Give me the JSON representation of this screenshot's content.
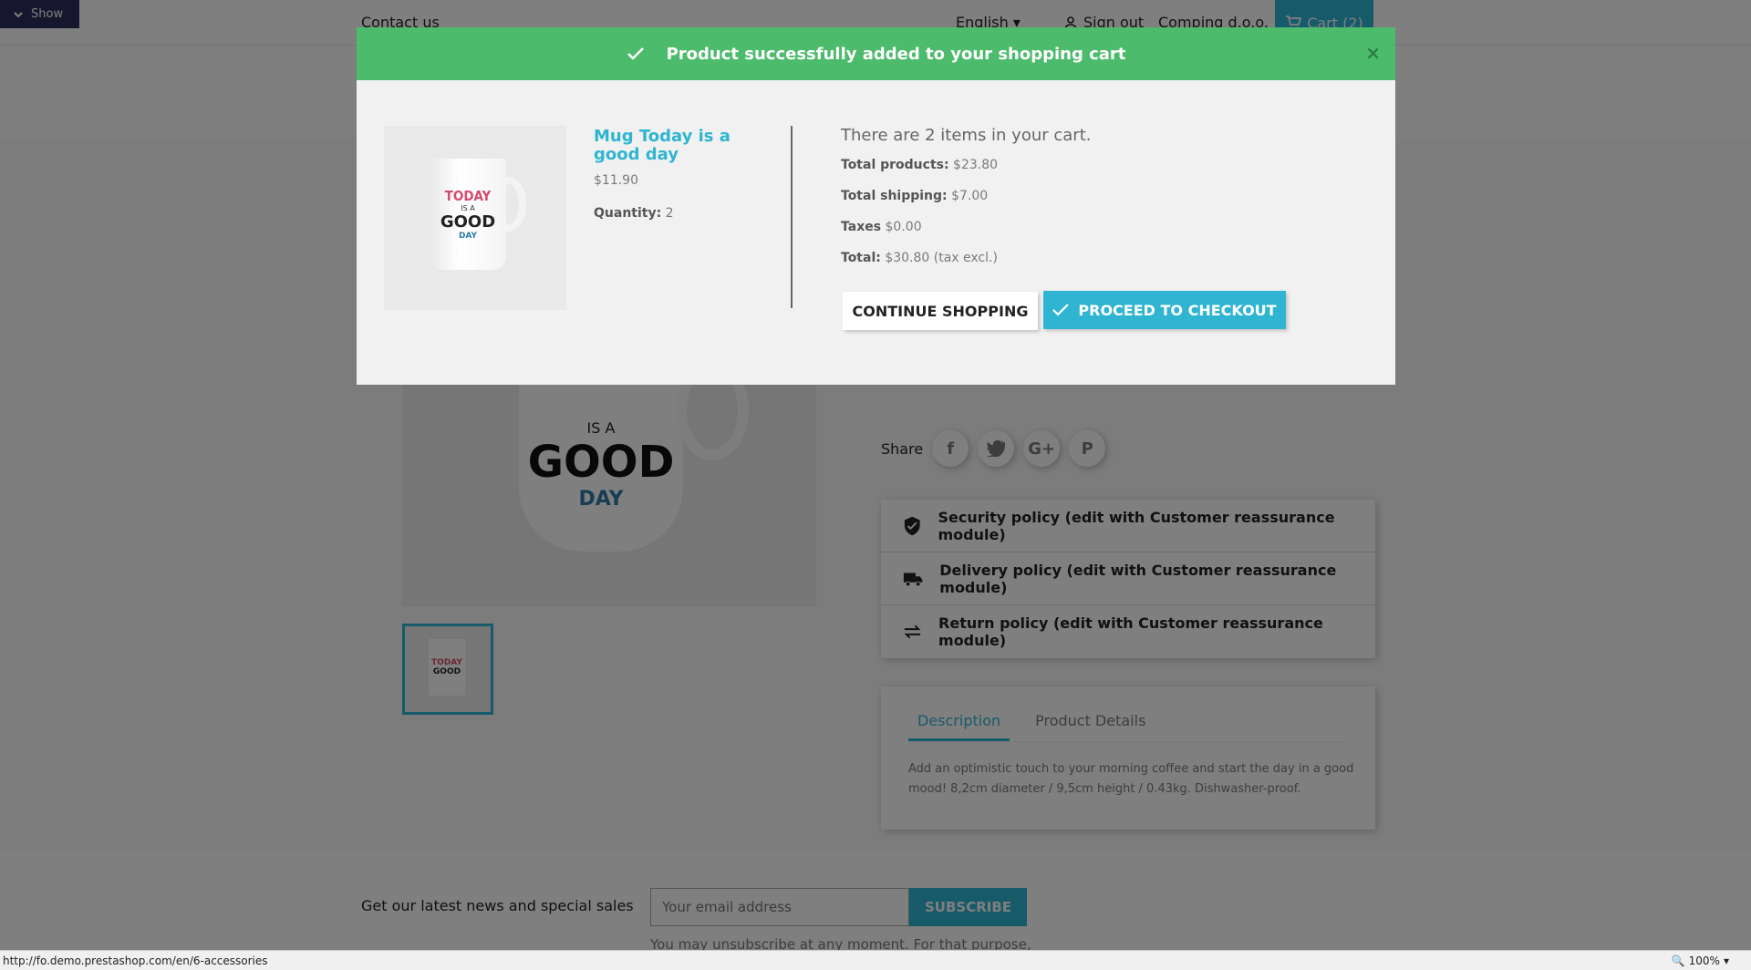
{
  "debug": {
    "label": "Show"
  },
  "header": {
    "contact": "Contact us",
    "language": "English",
    "signout": "Sign out",
    "company": "Comping d.o.o.",
    "cart": "Cart (2)"
  },
  "product_page": {
    "share_label": "Share",
    "share_icons": [
      "facebook-icon",
      "twitter-icon",
      "googleplus-icon",
      "pinterest-icon"
    ],
    "reassurance": [
      "Security policy (edit with Customer reassurance module)",
      "Delivery policy (edit with Customer reassurance module)",
      "Return policy (edit with Customer reassurance module)"
    ],
    "tabs": [
      "Description",
      "Product Details"
    ],
    "description": "Add an optimistic touch to your morning coffee and start the day in a good mood! 8,2cm diameter / 9,5cm height / 0.43kg. Dishwasher-proof."
  },
  "newsletter": {
    "label": "Get our latest news and special sales",
    "placeholder": "Your email address",
    "button": "SUBSCRIBE",
    "note": "You may unsubscribe at any moment. For that purpose,"
  },
  "modal": {
    "title": "Product successfully added to your shopping cart",
    "close": "×",
    "product": {
      "name": "Mug Today is a good day",
      "price": "$11.90",
      "quantity_label": "Quantity:",
      "quantity": "2"
    },
    "mug_text": {
      "line1": "TODAY",
      "line2": "IS A",
      "line3": "GOOD",
      "line4": "DAY"
    },
    "summary": {
      "count": "There are 2 items in your cart.",
      "products_label": "Total products:",
      "products_value": "$23.80",
      "shipping_label": "Total shipping:",
      "shipping_value": "$7.00",
      "taxes_label": "Taxes",
      "taxes_value": "$0.00",
      "total_label": "Total:",
      "total_value": "$30.80 (tax excl.)"
    },
    "continue": "CONTINUE SHOPPING",
    "checkout": "PROCEED TO CHECKOUT"
  },
  "statusbar": {
    "url": "http://fo.demo.prestashop.com/en/6-accessories",
    "zoom": "100%"
  },
  "colors": {
    "accent": "#2fb5d2",
    "success": "#4cbb6c"
  }
}
